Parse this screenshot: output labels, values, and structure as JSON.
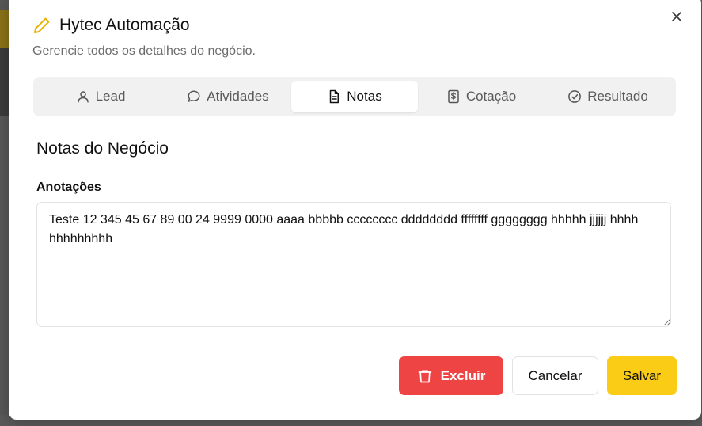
{
  "dialog": {
    "title": "Hytec Automação",
    "subtitle": "Gerencie todos os detalhes do negócio.",
    "title_icon": "pencil-icon",
    "accent_color": "#facc15"
  },
  "tabs": [
    {
      "label": "Lead",
      "icon": "user-icon",
      "active": false
    },
    {
      "label": "Atividades",
      "icon": "message-circle-icon",
      "active": false
    },
    {
      "label": "Notas",
      "icon": "file-text-icon",
      "active": true
    },
    {
      "label": "Cotação",
      "icon": "dollar-receipt-icon",
      "active": false
    },
    {
      "label": "Resultado",
      "icon": "check-circle-icon",
      "active": false
    }
  ],
  "notes_section": {
    "title": "Notas do Negócio",
    "field_label": "Anotações",
    "value": "Teste 12 345 45 67 89 00 24 9999 0000 aaaa bbbbb cccccccc dddddddd ffffffff gggggggg hhhhh jjjjjj hhhh hhhhhhhhh"
  },
  "actions": {
    "delete_label": "Excluir",
    "cancel_label": "Cancelar",
    "save_label": "Salvar",
    "delete_color": "#ef4444",
    "save_color": "#facc15"
  }
}
